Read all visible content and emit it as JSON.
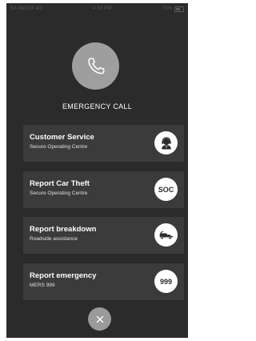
{
  "status_bar": {
    "carrier": "SA MAXIS 4G",
    "time": "4:33 PM",
    "battery": "73%"
  },
  "header": {
    "title": "EMERGENCY CALL",
    "icon": "phone-icon"
  },
  "options": [
    {
      "label": "Customer Service",
      "subtitle": "Secure Operating Centre",
      "badge_icon": "headset-agent-icon",
      "badge_text": ""
    },
    {
      "label": "Report Car Theft",
      "subtitle": "Secure Operating Centre",
      "badge_icon": "",
      "badge_text": "SOC"
    },
    {
      "label": "Report breakdown",
      "subtitle": "Roadside assistance",
      "badge_icon": "tow-truck-icon",
      "badge_text": ""
    },
    {
      "label": "Report emergency",
      "subtitle": "MERS 999",
      "badge_icon": "",
      "badge_text": "999"
    }
  ],
  "footer": {
    "close_icon": "close-icon"
  },
  "colors": {
    "background": "#2b2b2b",
    "card": "#3b3b3b",
    "accent_circle": "#9e9e9e"
  }
}
